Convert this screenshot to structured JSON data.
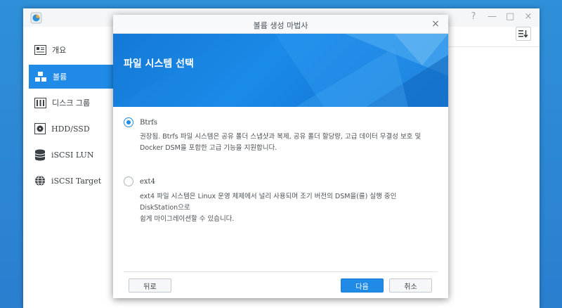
{
  "sidebar": {
    "items": [
      {
        "label": "개요",
        "icon": "overview-icon"
      },
      {
        "label": "볼륨",
        "icon": "volume-icon",
        "active": true
      },
      {
        "label": "디스크 그룹",
        "icon": "disk-group-icon"
      },
      {
        "label": "HDD/SSD",
        "icon": "hdd-icon"
      },
      {
        "label": "iSCSI LUN",
        "icon": "iscsi-lun-icon"
      },
      {
        "label": "iSCSI Target",
        "icon": "iscsi-target-icon"
      }
    ]
  },
  "window_controls": {
    "help": "?",
    "minimize": "—",
    "maximize": "□",
    "close": "×"
  },
  "dialog": {
    "title": "볼륨 생성 마법사",
    "close": "×",
    "banner_title": "파일 시스템 선택",
    "options": [
      {
        "label": "Btrfs",
        "checked": true,
        "desc_line1": "권장됨. Btrfs 파일 시스템은 공유 폴더 스냅샷과 복제, 공유 폴더 할당량, 고급 데이터 무결성 보호 및",
        "desc_line2": "Docker DSM을 포함한 고급 기능을 지원합니다."
      },
      {
        "label": "ext4",
        "checked": false,
        "desc_line1": "ext4 파일 시스템은 Linux 운영 체제에서 널리 사용되며 조기 버전의 DSM을(를) 실행 중인 DiskStation으로",
        "desc_line2": "쉽게 마이그레이션할 수 있습니다."
      }
    ],
    "buttons": {
      "back": "뒤로",
      "next": "다음",
      "cancel": "취소"
    }
  },
  "colors": {
    "accent": "#1f8be6",
    "desktop": "#2f8fd8"
  }
}
